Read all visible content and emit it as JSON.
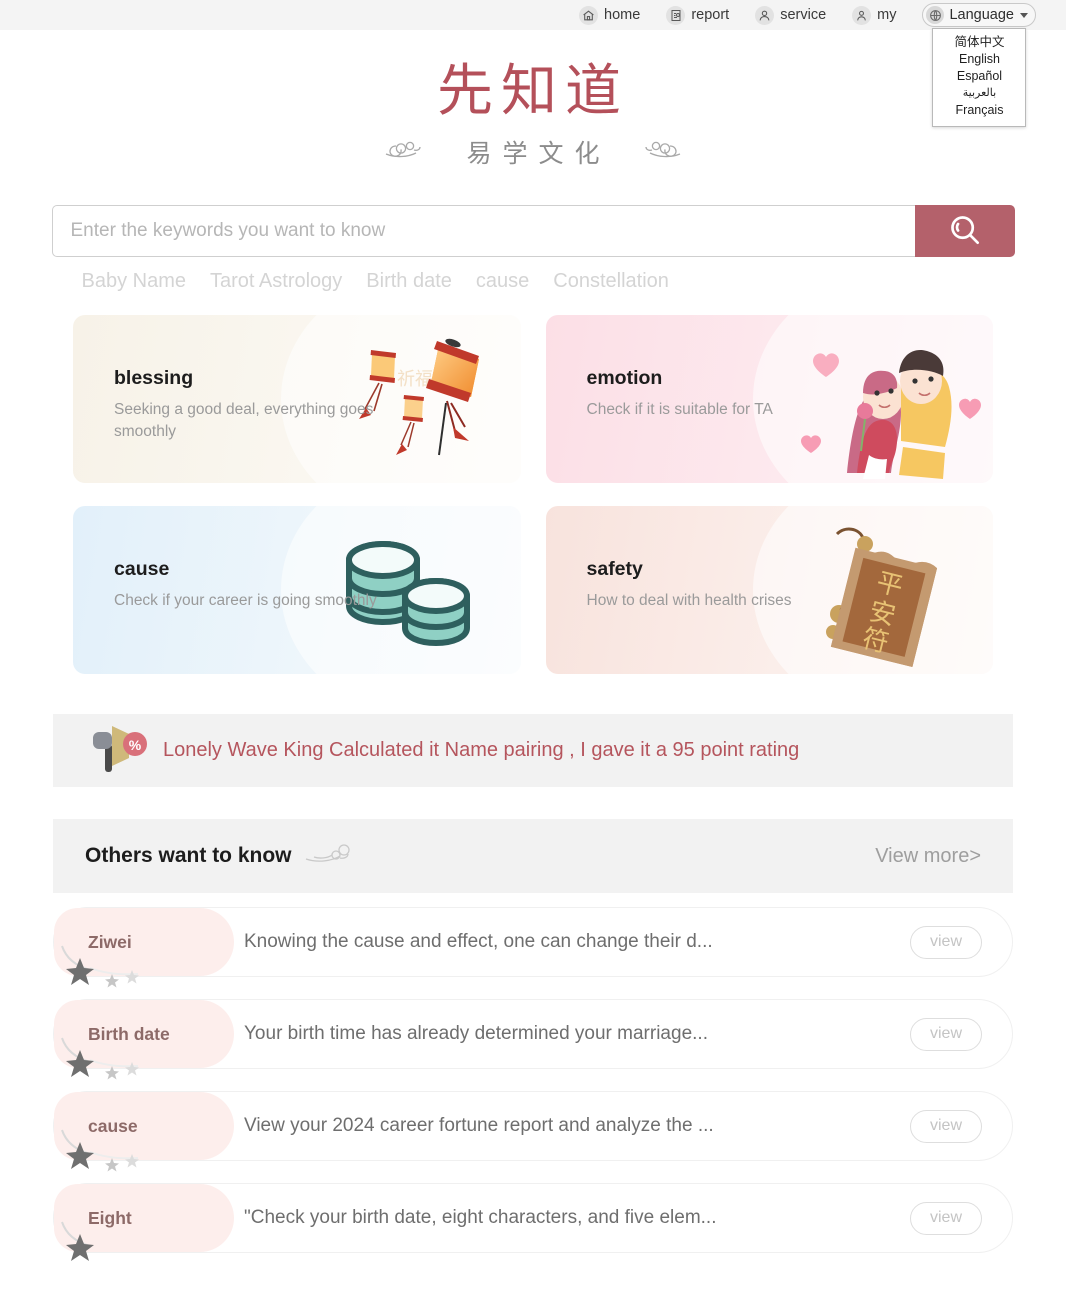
{
  "topnav": {
    "items": [
      {
        "label": "home",
        "icon": "home-icon"
      },
      {
        "label": "report",
        "icon": "report-icon"
      },
      {
        "label": "service",
        "icon": "service-icon"
      },
      {
        "label": "my",
        "icon": "user-icon"
      }
    ],
    "language": {
      "label": "Language",
      "icon": "globe-icon",
      "options": [
        "简体中文",
        "English",
        "Español",
        "بالعربية",
        "Français"
      ]
    }
  },
  "logo": {
    "main": "先知道",
    "sub": "易学文化"
  },
  "search": {
    "placeholder": "Enter the keywords you want to know",
    "value": "",
    "button_icon": "search-icon",
    "button_color": "#b4616b"
  },
  "quick_tags": [
    "Baby Name",
    "Tarot Astrology",
    "Birth date",
    "cause",
    "Constellation"
  ],
  "cards": [
    {
      "key": "blessing",
      "title": "blessing",
      "desc": "Seeking a good deal, everything goes smoothly",
      "art": "lanterns-illustration",
      "bg": "#f7f2e8"
    },
    {
      "key": "emotion",
      "title": "emotion",
      "desc": "Check if it is suitable for TA",
      "art": "couple-illustration",
      "bg": "#fcdfe6"
    },
    {
      "key": "cause",
      "title": "cause",
      "desc": "Check if your career is going smoothly",
      "art": "coins-illustration",
      "bg": "#e2f0fa"
    },
    {
      "key": "safety",
      "title": "safety",
      "desc": "How to deal with health crises",
      "art": "amulet-illustration",
      "bg": "#f8e3dd"
    }
  ],
  "announcement": {
    "icon": "megaphone-percent-icon",
    "text": "Lonely Wave King Calculated it  Name pairing ,  I gave it a 95 point rating",
    "color": "#b5555d"
  },
  "section": {
    "title": "Others want to know",
    "cloud_icon": "cloud-ornament-icon",
    "view_more": "View more>"
  },
  "list": [
    {
      "tag": "Ziwei",
      "text": "Knowing the cause and effect, one can change their d...",
      "button": "view"
    },
    {
      "tag": "Birth date",
      "text": "Your birth time has already determined your marriage...",
      "button": "view"
    },
    {
      "tag": "cause",
      "text": "View your 2024 career fortune report and analyze the ...",
      "button": "view"
    },
    {
      "tag": "Eight",
      "text": "\"Check your birth date, eight characters, and five elem...",
      "button": "view"
    }
  ]
}
